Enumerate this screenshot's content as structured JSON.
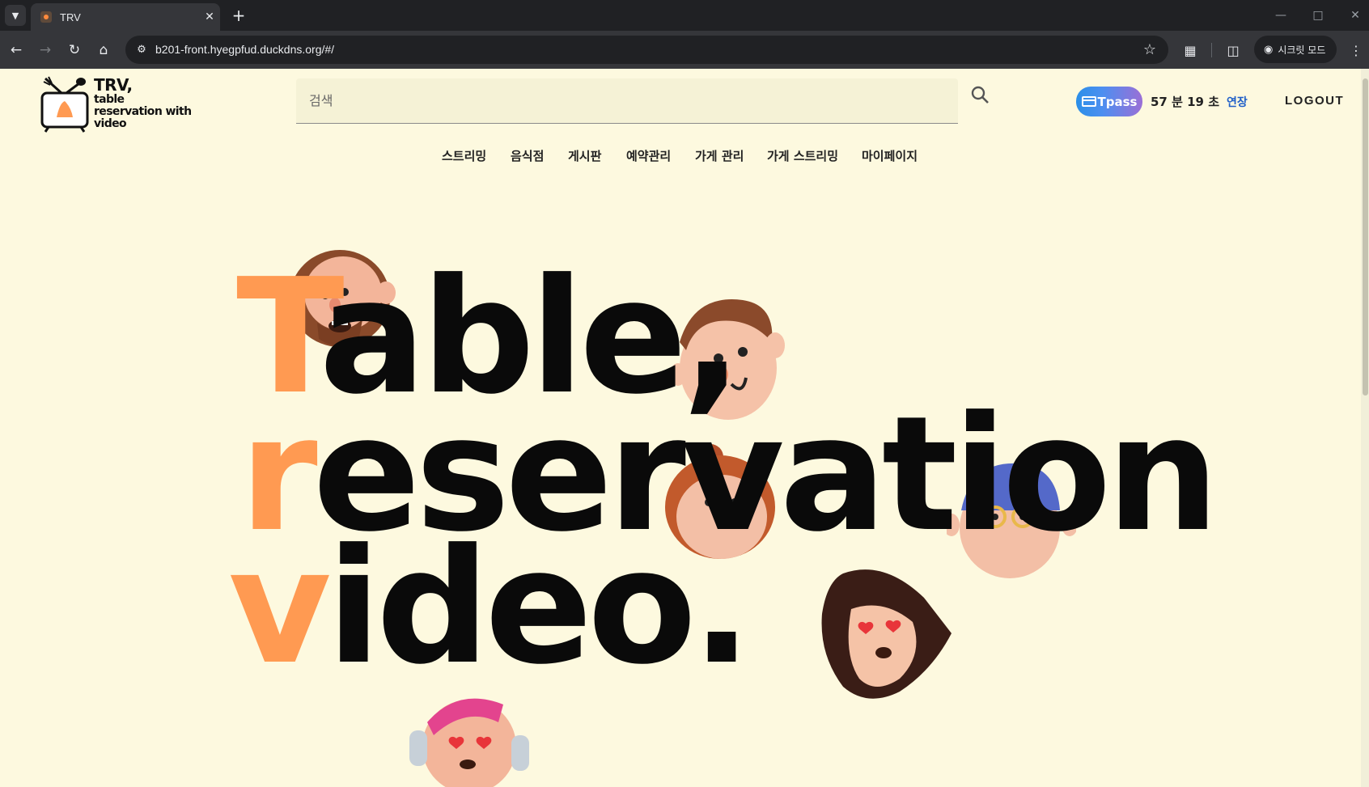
{
  "browser": {
    "tab_title": "TRV",
    "url": "b201-front.hyegpfud.duckdns.org/#/",
    "incognito_label": "시크릿 모드"
  },
  "header": {
    "logo_title": "TRV,",
    "logo_subtitle_1": "table",
    "logo_subtitle_2": "reservation with",
    "logo_subtitle_3": "video",
    "search_placeholder": "검색",
    "tpass_label": "Tpass",
    "timer_text": "57 분 19 초",
    "extend_label": "연장",
    "logout_label": "LOGOUT"
  },
  "nav": {
    "items": [
      "스트리밍",
      "음식점",
      "게시판",
      "예약관리",
      "가게 관리",
      "가게 스트리밍",
      "마이페이지"
    ]
  },
  "hero": {
    "line1_accent": "T",
    "line1_rest": "able,",
    "line2_accent": "r",
    "line2_rest": "eservation",
    "line3_accent": "v",
    "line3_rest": "ideo."
  },
  "colors": {
    "page_bg": "#fdf9df",
    "accent": "#ff9a52",
    "tpass_gradient_start": "#2b8fe8",
    "tpass_gradient_end": "#9b6fd6",
    "extend_link": "#1f5fc8"
  }
}
